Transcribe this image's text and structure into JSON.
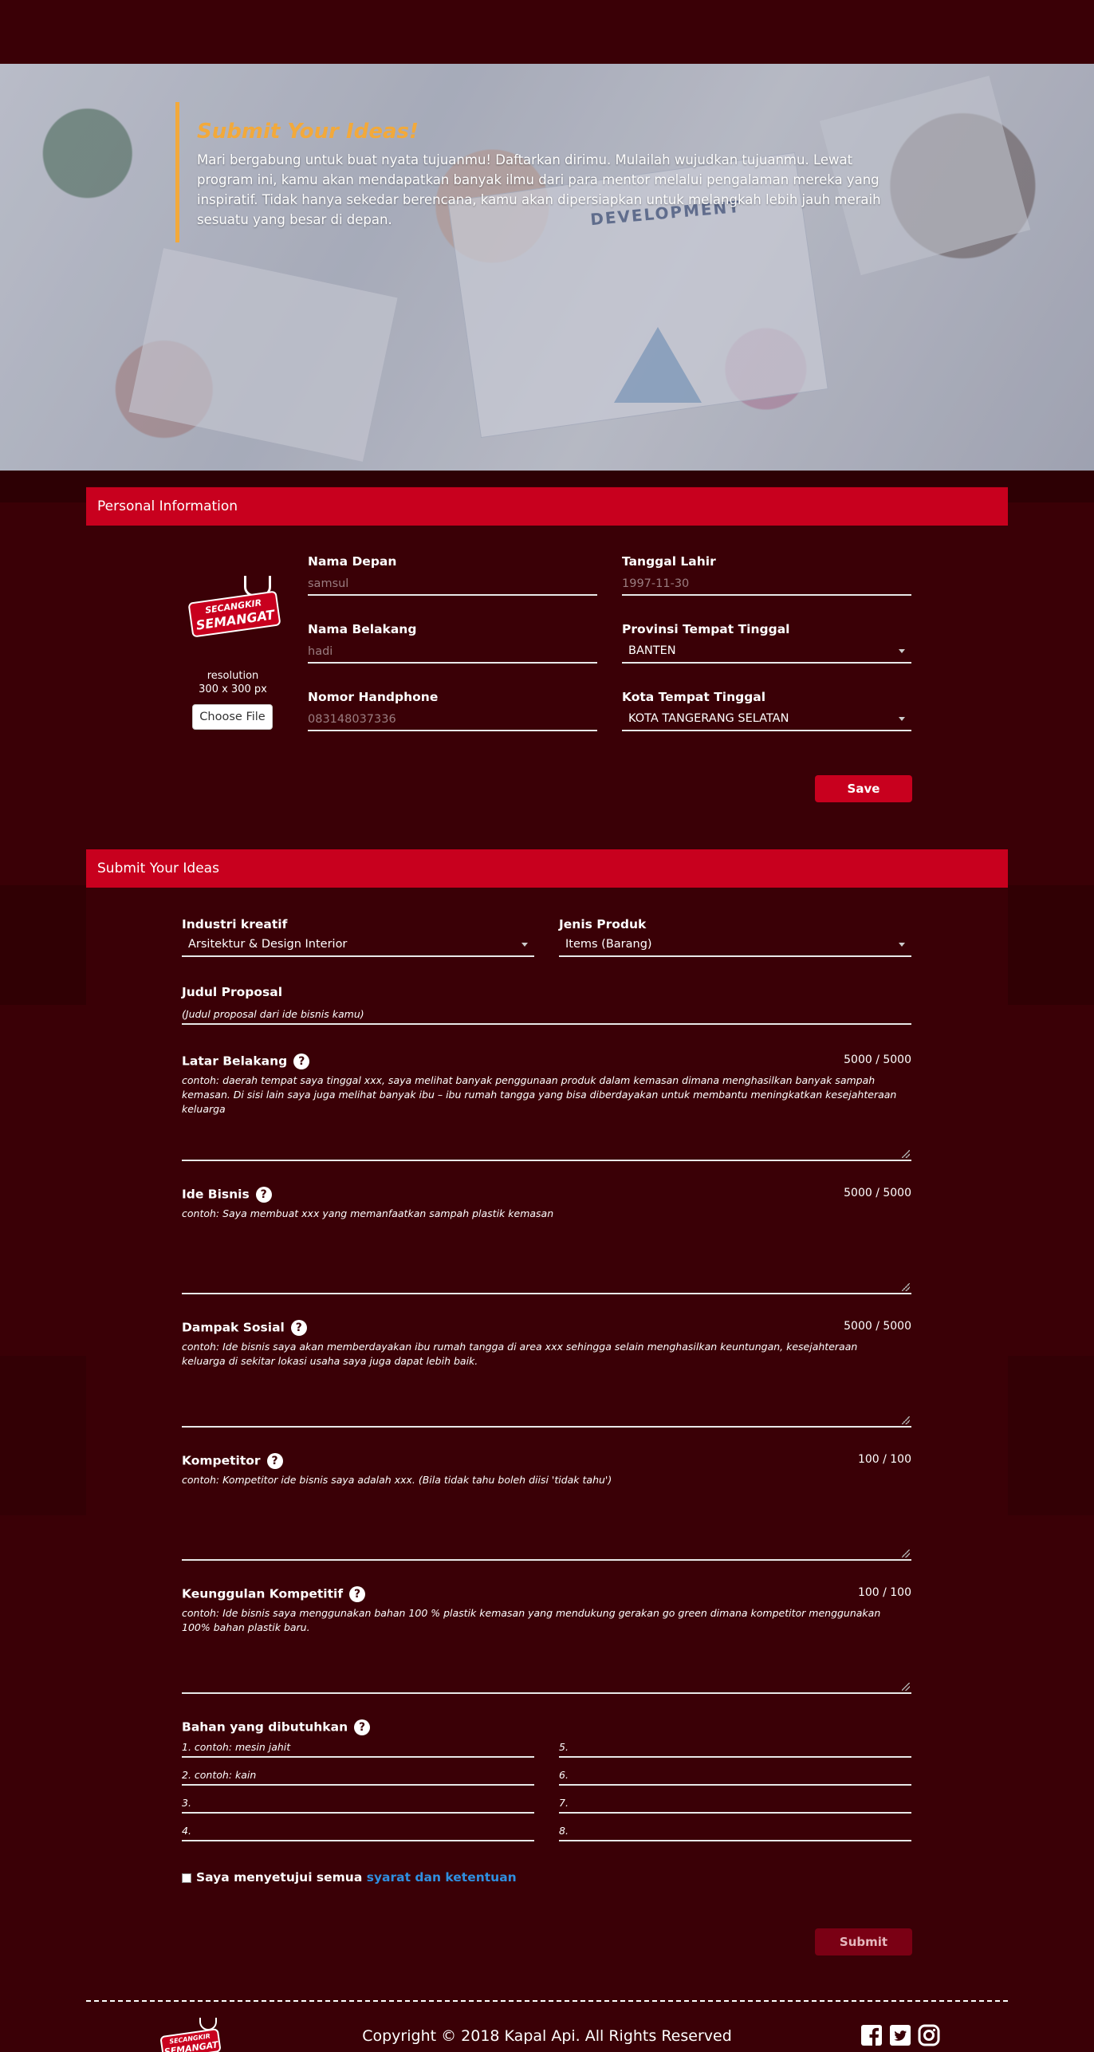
{
  "hero": {
    "title": "Submit Your Ideas!",
    "text": "Mari bergabung untuk buat nyata tujuanmu! Daftarkan dirimu. Mulailah wujudkan tujuanmu. Lewat program ini, kamu akan mendapatkan banyak ilmu dari para mentor melalui pengalaman mereka yang inspiratif. Tidak hanya sekedar berencana, kamu akan dipersiapkan untuk melangkah lebih jauh meraih sesuatu yang besar di depan.",
    "photo_word": "DEVELOPMENT"
  },
  "logo": {
    "line1": "SECANGKIR",
    "line2": "SEMANGAT"
  },
  "personal": {
    "header": "Personal Information",
    "resolution_line1": "resolution",
    "resolution_line2": "300 x 300 px",
    "choose_file": "Choose File",
    "first_name": {
      "label": "Nama Depan",
      "value": "samsul"
    },
    "last_name": {
      "label": "Nama Belakang",
      "value": "hadi"
    },
    "phone": {
      "label": "Nomor Handphone",
      "value": "083148037336"
    },
    "birth_date": {
      "label": "Tanggal Lahir",
      "value": "1997-11-30"
    },
    "province": {
      "label": "Provinsi Tempat Tinggal",
      "value": "BANTEN"
    },
    "city": {
      "label": "Kota Tempat Tinggal",
      "value": "KOTA TANGERANG SELATAN"
    },
    "save": "Save"
  },
  "ideas": {
    "header": "Submit Your Ideas",
    "industry": {
      "label": "Industri kreatif",
      "value": "Arsitektur & Design Interior"
    },
    "product": {
      "label": "Jenis Produk",
      "value": "Items (Barang)"
    },
    "proposal": {
      "label": "Judul Proposal",
      "placeholder": "(Judul proposal dari ide bisnis kamu)"
    },
    "background": {
      "label": "Latar Belakang",
      "counter": "5000 / 5000",
      "placeholder": "contoh: daerah tempat saya tinggal xxx, saya melihat banyak penggunaan produk dalam kemasan dimana menghasilkan banyak sampah kemasan. Di sisi lain saya juga melihat banyak ibu – ibu rumah tangga yang bisa diberdayakan untuk membantu meningkatkan kesejahteraan keluarga"
    },
    "business": {
      "label": "Ide Bisnis",
      "counter": "5000 / 5000",
      "placeholder": "contoh: Saya membuat xxx yang memanfaatkan sampah plastik kemasan"
    },
    "impact": {
      "label": "Dampak Sosial",
      "counter": "5000 / 5000",
      "placeholder": "contoh: Ide bisnis saya akan memberdayakan ibu rumah tangga  di area xxx sehingga selain menghasilkan keuntungan, kesejahteraan keluarga di sekitar lokasi usaha saya juga dapat lebih baik."
    },
    "competitor": {
      "label": "Kompetitor",
      "counter": "100 / 100",
      "placeholder": "contoh: Kompetitor ide bisnis saya adalah xxx. (Bila tidak tahu boleh diisi 'tidak tahu')"
    },
    "advantage": {
      "label": "Keunggulan Kompetitif",
      "counter": "100 / 100",
      "placeholder": "contoh: Ide bisnis saya menggunakan bahan 100 % plastik kemasan yang mendukung gerakan go green dimana kompetitor menggunakan 100% bahan plastik baru."
    },
    "materials": {
      "label": "Bahan yang dibutuhkan",
      "items": [
        "1. contoh: mesin jahit",
        "2. contoh: kain",
        "3.",
        "4.",
        "5.",
        "6.",
        "7.",
        "8."
      ]
    },
    "agree_text": "Saya menyetujui semua",
    "agree_link": "syarat dan ketentuan",
    "submit": "Submit",
    "help_glyph": "?"
  },
  "footer": {
    "copyright": "Copyright © 2018 Kapal Api. All Rights Reserved",
    "social": [
      "facebook-icon",
      "twitter-icon",
      "instagram-icon"
    ]
  },
  "colors": {
    "primary": "#c8001e",
    "background": "#3a0006",
    "accent": "#f2a93b",
    "link": "#2f8fe0"
  }
}
